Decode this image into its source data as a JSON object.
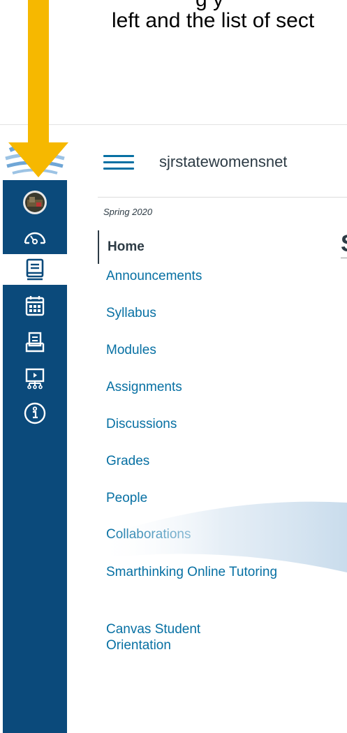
{
  "caption": {
    "line1_fragment": "g y",
    "line2": "left and the list of sect"
  },
  "header": {
    "breadcrumb": "sjrstatewomensnet"
  },
  "global_nav": {
    "icons": [
      "avatar-icon",
      "dashboard-icon",
      "courses-icon",
      "calendar-icon",
      "inbox-icon",
      "studio-icon",
      "help-icon"
    ],
    "active": "courses-icon"
  },
  "course": {
    "term": "Spring 2020",
    "page_title_fragment": "S"
  },
  "course_nav": {
    "items": [
      {
        "label": "Home",
        "active": true
      },
      {
        "label": "Announcements"
      },
      {
        "label": "Syllabus"
      },
      {
        "label": "Modules"
      },
      {
        "label": "Assignments"
      },
      {
        "label": "Discussions"
      },
      {
        "label": "Grades"
      },
      {
        "label": "People"
      },
      {
        "label": "Collaborations"
      },
      {
        "label": "Smarthinking Online Tutoring"
      },
      {
        "label": "Canvas Student Orientation"
      }
    ]
  },
  "colors": {
    "nav_bg": "#0B4A7B",
    "link": "#0770A3",
    "text": "#2D3B45",
    "arrow": "#F6B800"
  }
}
